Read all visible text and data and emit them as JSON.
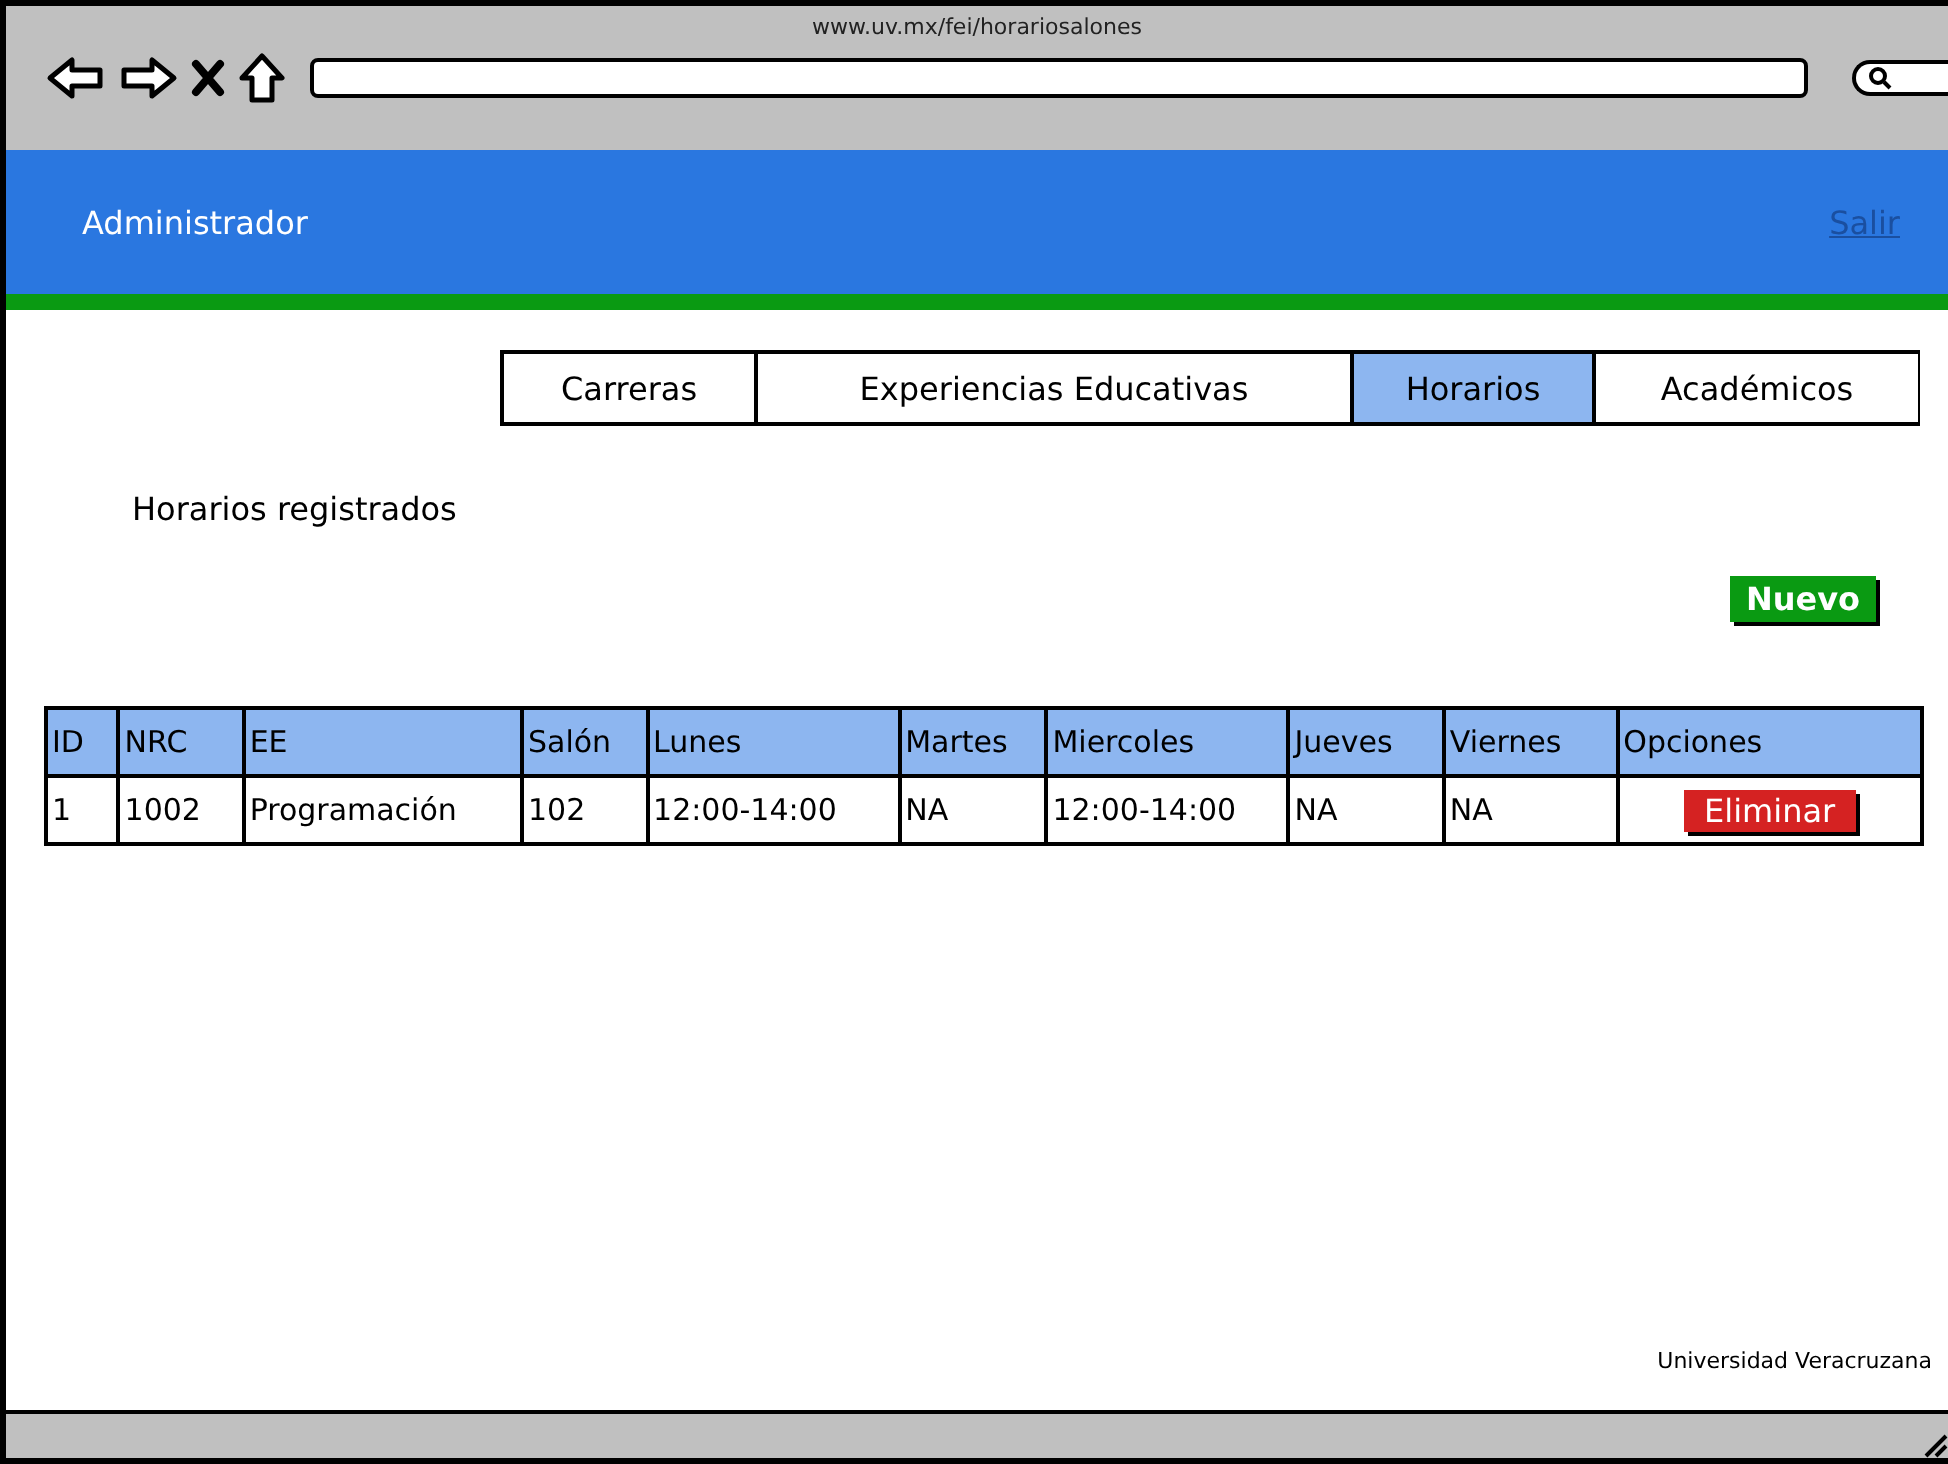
{
  "browser": {
    "url": "www.uv.mx/fei/horariosalones"
  },
  "header": {
    "title": "Administrador",
    "logout_link": "Salir"
  },
  "tabs": [
    {
      "label": "Carreras",
      "selected": false
    },
    {
      "label": "Experiencias Educativas",
      "selected": false
    },
    {
      "label": "Horarios",
      "selected": true
    },
    {
      "label": "Académicos",
      "selected": false
    }
  ],
  "section_title": "Horarios registrados",
  "new_button": "Nuevo",
  "table": {
    "columns": [
      "ID",
      "NRC",
      "EE",
      "Salón",
      "Lunes",
      "Martes",
      "Miercoles",
      "Jueves",
      "Viernes",
      "Opciones"
    ],
    "rows": [
      {
        "cells": [
          "1",
          "1002",
          "Programación",
          "102",
          "12:00-14:00",
          "NA",
          "12:00-14:00",
          "NA",
          "NA"
        ],
        "action": "Eliminar"
      }
    ]
  },
  "footer": "Universidad Veracruzana"
}
